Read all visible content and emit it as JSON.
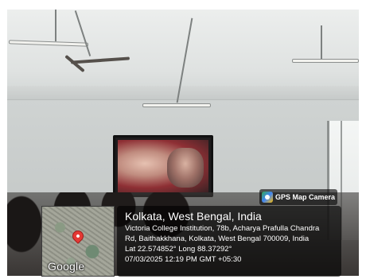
{
  "map": {
    "logo_text": "Google"
  },
  "badge": {
    "label": "GPS Map Camera"
  },
  "location": {
    "title": "Kolkata, West Bengal, India",
    "address_line1": "Victoria College Institution, 78b, Acharya Prafulla Chandra",
    "address_line2": "Rd, Baithakkhana, Kolkata, West Bengal 700009, India",
    "coordinates": "Lat 22.574852° Long 88.37292°",
    "datetime": "07/03/2025 12:19 PM GMT +05:30"
  },
  "colors": {
    "pin": "#e53935",
    "overlay": "#000000"
  }
}
